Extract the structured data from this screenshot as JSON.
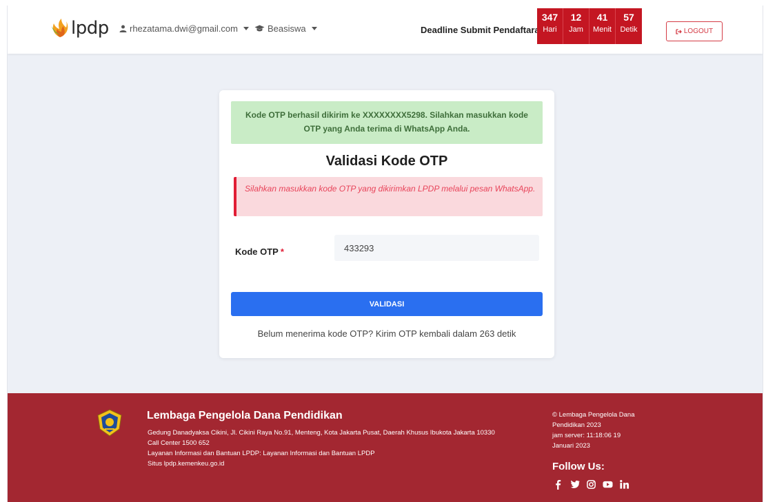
{
  "header": {
    "logo_text": "lpdp",
    "user_email": "rhezatama.dwi@gmail.com",
    "beasiswa_label": "Beasiswa",
    "deadline_label": "Deadline Submit Pendaftaran:",
    "countdown": [
      {
        "value": "347",
        "unit": "Hari"
      },
      {
        "value": "12",
        "unit": "Jam"
      },
      {
        "value": "41",
        "unit": "Menit"
      },
      {
        "value": "57",
        "unit": "Detik"
      }
    ],
    "logout_label": "LOGOUT",
    "icons": {
      "user": "user-icon",
      "beasiswa": "graduation-cap-icon",
      "logout": "sign-out-icon"
    }
  },
  "card": {
    "success_message": "Kode OTP berhasil dikirim ke XXXXXXXX5298. Silahkan masukkan kode OTP yang Anda terima di WhatsApp Anda.",
    "title": "Validasi Kode OTP",
    "danger_message": "Silahkan masukkan kode OTP yang dikirimkan LPDP melalui pesan WhatsApp.",
    "otp_label": "Kode OTP",
    "otp_required_mark": "*",
    "otp_value": "433293",
    "validate_label": "VALIDASI",
    "resend_text": "Belum menerima kode OTP? Kirim OTP kembali dalam 263 detik"
  },
  "footer": {
    "org_name": "Lembaga Pengelola Dana Pendidikan",
    "address": "Gedung Danadyaksa Cikini, Jl. Cikini Raya No.91, Menteng, Kota Jakarta Pusat, Daerah Khusus Ibukota Jakarta 10330",
    "call_center": "Call Center 1500 652",
    "info_line": "Layanan Informasi dan Bantuan LPDP: Layanan Informasi dan Bantuan LPDP",
    "site": "Situs lpdp.kemenkeu.go.id",
    "copyright_1": "© Lembaga Pengelola Dana",
    "copyright_2": "Pendidikan 2023",
    "server_time_1": "jam server: 11:18:06 19",
    "server_time_2": "Januari 2023",
    "follow_label": "Follow Us:",
    "social": [
      "facebook-icon",
      "twitter-icon",
      "instagram-icon",
      "youtube-icon",
      "linkedin-icon"
    ]
  },
  "colors": {
    "brand_red": "#c41622",
    "footer_red": "#a32731",
    "primary_blue": "#2a6ff0",
    "success_bg": "#c9ecc6",
    "danger_bg": "#fad9dd"
  }
}
